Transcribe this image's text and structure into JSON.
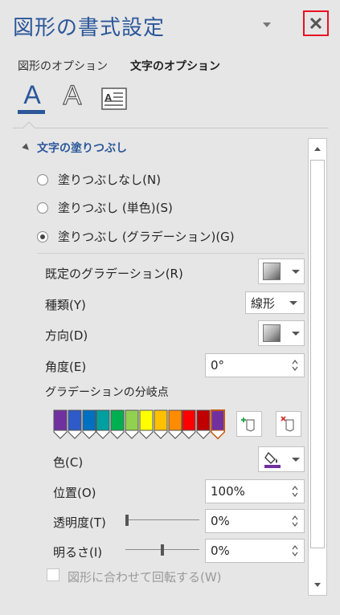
{
  "pane": {
    "title": "図形の書式設定"
  },
  "tabs": [
    {
      "label": "図形のオプション"
    },
    {
      "label": "文字のオプション"
    }
  ],
  "icons": {
    "text_fill_glyph": "A",
    "text_outline_glyph": "A"
  },
  "section": {
    "title": "文字の塗りつぶし"
  },
  "fill_options": [
    {
      "label": "塗りつぶしなし(N)",
      "selected": false
    },
    {
      "label": "塗りつぶし (単色)(S)",
      "selected": false
    },
    {
      "label": "塗りつぶし (グラデーション)(G)",
      "selected": true
    }
  ],
  "props": {
    "preset": {
      "label": "既定のグラデーション(R)"
    },
    "type": {
      "label": "種類(Y)",
      "value": "線形"
    },
    "direction": {
      "label": "方向(D)"
    },
    "angle": {
      "label": "角度(E)",
      "value": "0°"
    },
    "stops_label": "グラデーションの分岐点",
    "color": {
      "label": "色(C)"
    },
    "position": {
      "label": "位置(O)",
      "value": "100%"
    },
    "transparency": {
      "label": "透明度(T)",
      "value": "0%",
      "level": 0
    },
    "brightness": {
      "label": "明るさ(I)",
      "value": "0%",
      "level": 0.5
    },
    "rotate": {
      "label": "図形に合わせて回転する(W)",
      "checked": false
    }
  },
  "gradient_stops": [
    {
      "color": "#7030a0"
    },
    {
      "color": "#2e5bc8"
    },
    {
      "color": "#0070c0"
    },
    {
      "color": "#00a0a0"
    },
    {
      "color": "#00b050"
    },
    {
      "color": "#92d050"
    },
    {
      "color": "#ffff00"
    },
    {
      "color": "#ffc000"
    },
    {
      "color": "#ff8c00"
    },
    {
      "color": "#ff0000"
    },
    {
      "color": "#c00000"
    },
    {
      "color": "#7030a0"
    }
  ],
  "colors": {
    "accent": "#2b579a",
    "close_border": "#e81123",
    "font_color_bar": "#7030a0"
  }
}
